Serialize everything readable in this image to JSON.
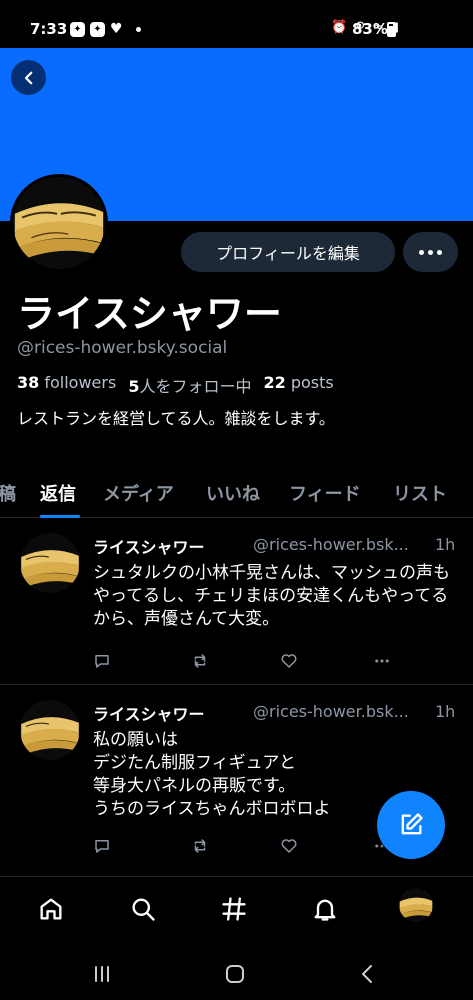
{
  "status": {
    "time": "7:33",
    "battery": "83%"
  },
  "profile": {
    "edit_button": "プロフィールを編集",
    "display_name": "ライスシャワー",
    "handle": "@rices-hower.bsky.social",
    "followers_count": "38",
    "followers_label": "followers",
    "following_count": "5",
    "following_label": "人をフォロー中",
    "posts_count": "22",
    "posts_label": "posts",
    "bio": "レストランを経営してる人。雑談をします。"
  },
  "tabs": [
    "稿",
    "返信",
    "メディア",
    "いいね",
    "フィード",
    "リスト"
  ],
  "active_tab": "返信",
  "posts": [
    {
      "name": "ライスシャワー",
      "handle": "@rices-hower.bsk...",
      "time": "1h",
      "text": "シュタルクの小林千晃さんは、マッシュの声もやってるし、チェリまほの安達くんもやってるから、声優さんて大変。"
    },
    {
      "name": "ライスシャワー",
      "handle": "@rices-hower.bsk...",
      "time": "1h",
      "text": "私の願いは\n デジたん制服フィギュアと\n等身大パネルの再販です。\nうちのライスちゃんボロボロよ"
    }
  ],
  "colors": {
    "banner": "#0a6cff",
    "accent": "#1083fe",
    "button_bg": "#1e2937",
    "muted_text": "#8c96a3",
    "background": "#000000"
  },
  "icons": {
    "back": "back-arrow-icon",
    "more": "more-dots-icon",
    "reply": "reply-icon",
    "repost": "repost-icon",
    "like": "heart-icon",
    "post_more": "more-dots-icon",
    "compose": "compose-icon",
    "home": "home-icon",
    "search": "search-icon",
    "feeds": "hashtag-icon",
    "notifications": "bell-icon"
  }
}
